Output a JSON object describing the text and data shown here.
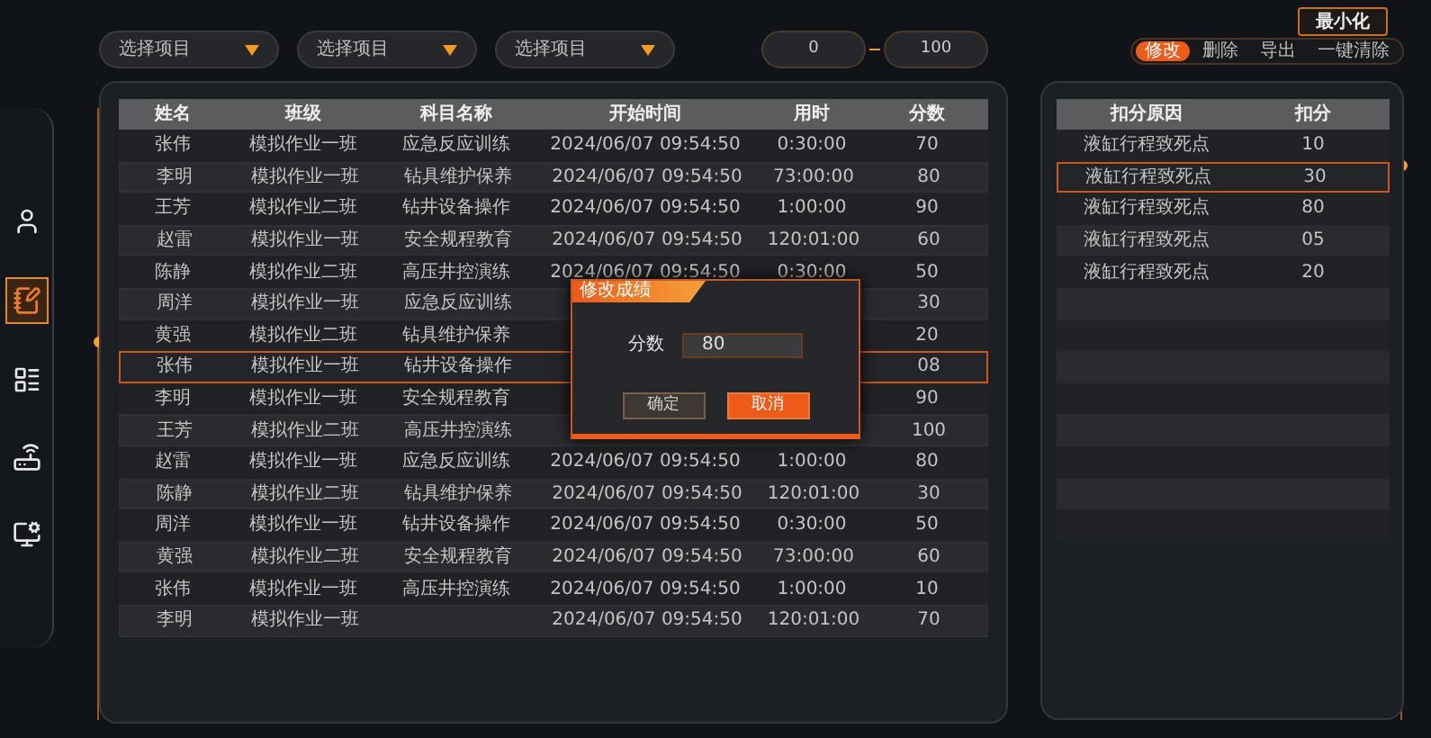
{
  "minimize_button": "最小化",
  "filters": [
    {
      "placeholder": "选择项目"
    },
    {
      "placeholder": "选择项目"
    },
    {
      "placeholder": "选择项目"
    }
  ],
  "range": {
    "min": "0",
    "max": "100"
  },
  "actions": [
    {
      "label": "修改",
      "selected": true
    },
    {
      "label": "删除",
      "selected": false
    },
    {
      "label": "导出",
      "selected": false
    },
    {
      "label": "一键清除",
      "selected": false
    }
  ],
  "sidebar": {
    "items": [
      {
        "kind": "person",
        "selected": false
      },
      {
        "kind": "note",
        "selected": true
      },
      {
        "kind": "list",
        "selected": false
      },
      {
        "kind": "router",
        "selected": false
      },
      {
        "kind": "monitor",
        "selected": false
      }
    ]
  },
  "scores_table": {
    "columns": [
      "姓名",
      "班级",
      "科目名称",
      "开始时间",
      "用时",
      "分数"
    ],
    "rows": [
      {
        "name": "张伟",
        "class": "模拟作业一班",
        "subject": "应急反应训练",
        "start": "2024/06/07 09:54:50",
        "duration": "0:30:00",
        "score": "70",
        "selected": false
      },
      {
        "name": "李明",
        "class": "模拟作业一班",
        "subject": "钻具维护保养",
        "start": "2024/06/07 09:54:50",
        "duration": "73:00:00",
        "score": "80",
        "selected": false
      },
      {
        "name": "王芳",
        "class": "模拟作业二班",
        "subject": "钻井设备操作",
        "start": "2024/06/07 09:54:50",
        "duration": "1:00:00",
        "score": "90",
        "selected": false
      },
      {
        "name": "赵雷",
        "class": "模拟作业一班",
        "subject": "安全规程教育",
        "start": "2024/06/07 09:54:50",
        "duration": "120:01:00",
        "score": "60",
        "selected": false
      },
      {
        "name": "陈静",
        "class": "模拟作业二班",
        "subject": "高压井控演练",
        "start": "2024/06/07 09:54:50",
        "duration": "0:30:00",
        "score": "50",
        "selected": false
      },
      {
        "name": "周洋",
        "class": "模拟作业一班",
        "subject": "应急反应训练",
        "score": "30",
        "selected": false
      },
      {
        "name": "黄强",
        "class": "模拟作业二班",
        "subject": "钻具维护保养",
        "score": "20",
        "selected": false
      },
      {
        "name": "张伟",
        "class": "模拟作业一班",
        "subject": "钻井设备操作",
        "score": "08",
        "selected": true
      },
      {
        "name": "李明",
        "class": "模拟作业一班",
        "subject": "安全规程教育",
        "score": "90",
        "selected": false
      },
      {
        "name": "王芳",
        "class": "模拟作业二班",
        "subject": "高压井控演练",
        "score": "100",
        "selected": false
      },
      {
        "name": "赵雷",
        "class": "模拟作业一班",
        "subject": "应急反应训练",
        "start": "2024/06/07 09:54:50",
        "duration": "1:00:00",
        "score": "80",
        "selected": false
      },
      {
        "name": "陈静",
        "class": "模拟作业二班",
        "subject": "钻具维护保养",
        "start": "2024/06/07 09:54:50",
        "duration": "120:01:00",
        "score": "30",
        "selected": false
      },
      {
        "name": "周洋",
        "class": "模拟作业一班",
        "subject": "钻井设备操作",
        "start": "2024/06/07 09:54:50",
        "duration": "0:30:00",
        "score": "50",
        "selected": false
      },
      {
        "name": "黄强",
        "class": "模拟作业二班",
        "subject": "安全规程教育",
        "start": "2024/06/07 09:54:50",
        "duration": "73:00:00",
        "score": "60",
        "selected": false
      },
      {
        "name": "张伟",
        "class": "模拟作业一班",
        "subject": "高压井控演练",
        "start": "2024/06/07 09:54:50",
        "duration": "1:00:00",
        "score": "10",
        "selected": false
      },
      {
        "name": "李明",
        "class": "模拟作业一班",
        "start": "2024/06/07 09:54:50",
        "duration": "120:01:00",
        "score": "70",
        "selected": false
      }
    ]
  },
  "deductions_table": {
    "columns": [
      "扣分原因",
      "扣分"
    ],
    "rows": [
      {
        "reason": "液缸行程致死点",
        "points": "10",
        "selected": false
      },
      {
        "reason": "液缸行程致死点",
        "points": "30",
        "selected": true
      },
      {
        "reason": "液缸行程致死点",
        "points": "80",
        "selected": false
      },
      {
        "reason": "液缸行程致死点",
        "points": "05",
        "selected": false
      },
      {
        "reason": "液缸行程致死点",
        "points": "20",
        "selected": false
      }
    ]
  },
  "dialog": {
    "title": "修改成绩",
    "field_label": "分数",
    "field_value": "80",
    "buttons": [
      {
        "label": "确定",
        "kind": "secondary"
      },
      {
        "label": "取消",
        "kind": "primary"
      }
    ]
  }
}
